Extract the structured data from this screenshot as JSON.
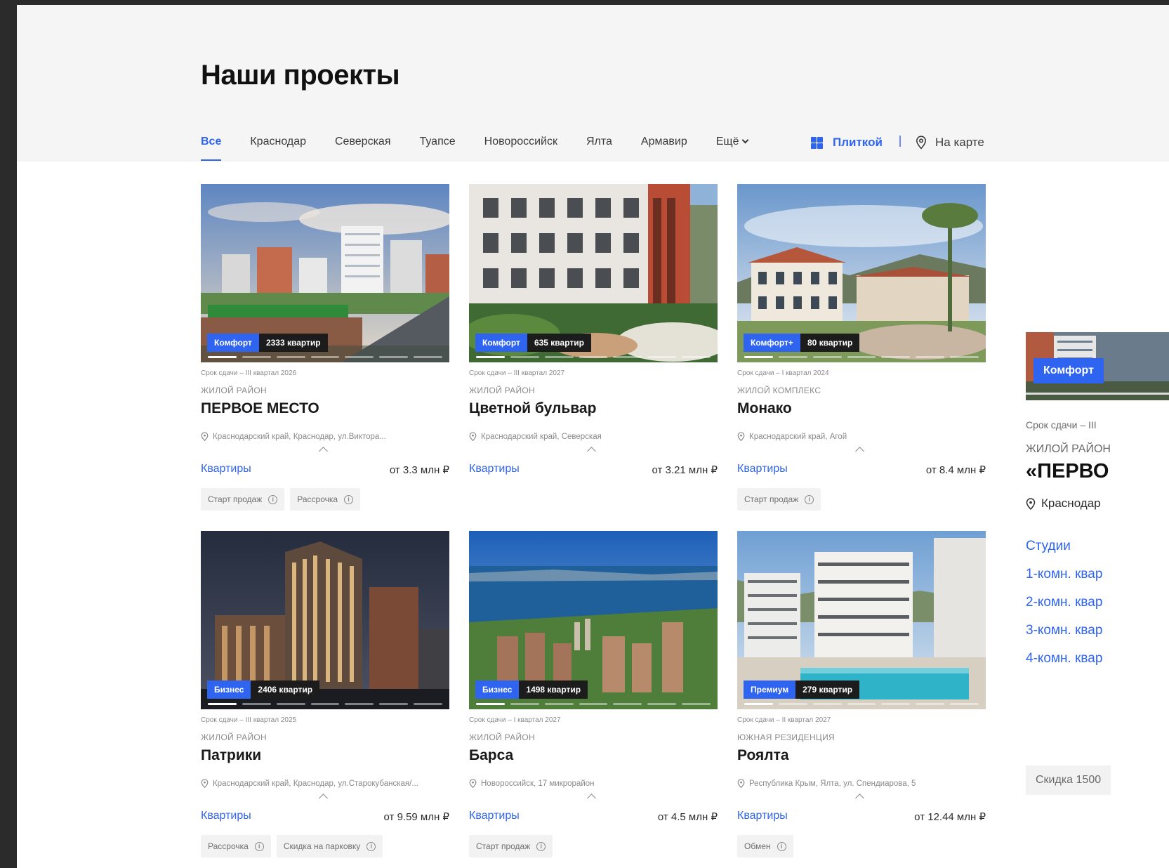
{
  "page": {
    "title": "Наши проекты"
  },
  "tabs": [
    {
      "label": "Все",
      "active": true
    },
    {
      "label": "Краснодар"
    },
    {
      "label": "Северская"
    },
    {
      "label": "Туапсе"
    },
    {
      "label": "Новороссийск"
    },
    {
      "label": "Ялта"
    },
    {
      "label": "Армавир"
    },
    {
      "label": "Ещё"
    }
  ],
  "view": {
    "tiles": "Плиткой",
    "map": "На карте"
  },
  "colors": {
    "accent": "#2f64f0",
    "badge_dark": "#1c1c1c"
  },
  "projects": [
    {
      "class": "Комфорт",
      "count": "2333 квартир",
      "deadline": "Срок сдачи – III квартал 2026",
      "type": "ЖИЛОЙ РАЙОН",
      "name": "ПЕРВОЕ МЕСТО",
      "address": "Краснодарский край, Краснодар, ул.Виктора...",
      "flats": "Квартиры",
      "price": "от 3.3 млн ₽",
      "tags": [
        "Старт продаж",
        "Рассрочка"
      ]
    },
    {
      "class": "Комфорт",
      "count": "635 квартир",
      "deadline": "Срок сдачи – III квартал 2027",
      "type": "ЖИЛОЙ РАЙОН",
      "name": "Цветной бульвар",
      "address": "Краснодарский край, Северская",
      "flats": "Квартиры",
      "price": "от 3.21 млн ₽",
      "tags": []
    },
    {
      "class": "Комфорт+",
      "count": "80 квартир",
      "deadline": "Срок сдачи – I квартал 2024",
      "type": "ЖИЛОЙ КОМПЛЕКС",
      "name": "Монако",
      "address": "Краснодарский край, Агой",
      "flats": "Квартиры",
      "price": "от 8.4 млн ₽",
      "tags": [
        "Старт продаж"
      ]
    },
    {
      "class": "Бизнес",
      "count": "2406 квартир",
      "deadline": "Срок сдачи – III квартал 2025",
      "type": "ЖИЛОЙ РАЙОН",
      "name": "Патрики",
      "address": "Краснодарский край, Краснодар, ул.Старокубанская/...",
      "flats": "Квартиры",
      "price": "от 9.59 млн ₽",
      "tags": [
        "Рассрочка",
        "Скидка на парковку"
      ]
    },
    {
      "class": "Бизнес",
      "count": "1498 квартир",
      "deadline": "Срок сдачи – I квартал 2027",
      "type": "ЖИЛОЙ РАЙОН",
      "name": "Барса",
      "address": "Новороссийск, 17 микрорайон",
      "flats": "Квартиры",
      "price": "от 4.5 млн ₽",
      "tags": [
        "Старт продаж"
      ]
    },
    {
      "class": "Премиум",
      "count": "279 квартир",
      "deadline": "Срок сдачи – II квартал 2027",
      "type": "ЮЖНАЯ РЕЗИДЕНЦИЯ",
      "name": "Роялта",
      "address": "Республика Крым, Ялта, ул. Спендиарова, 5",
      "flats": "Квартиры",
      "price": "от 12.44 млн ₽",
      "tags": [
        "Обмен"
      ]
    }
  ],
  "side": {
    "badge": "Комфорт",
    "deadline": "Срок сдачи – III",
    "type": "ЖИЛОЙ РАЙОН",
    "name": "«ПЕРВО",
    "address": "Краснодар",
    "links": [
      "Студии",
      "1-комн. квар",
      "2-комн. квар",
      "3-комн. квар",
      "4-комн. квар"
    ],
    "discount": "Скидка 1500"
  }
}
